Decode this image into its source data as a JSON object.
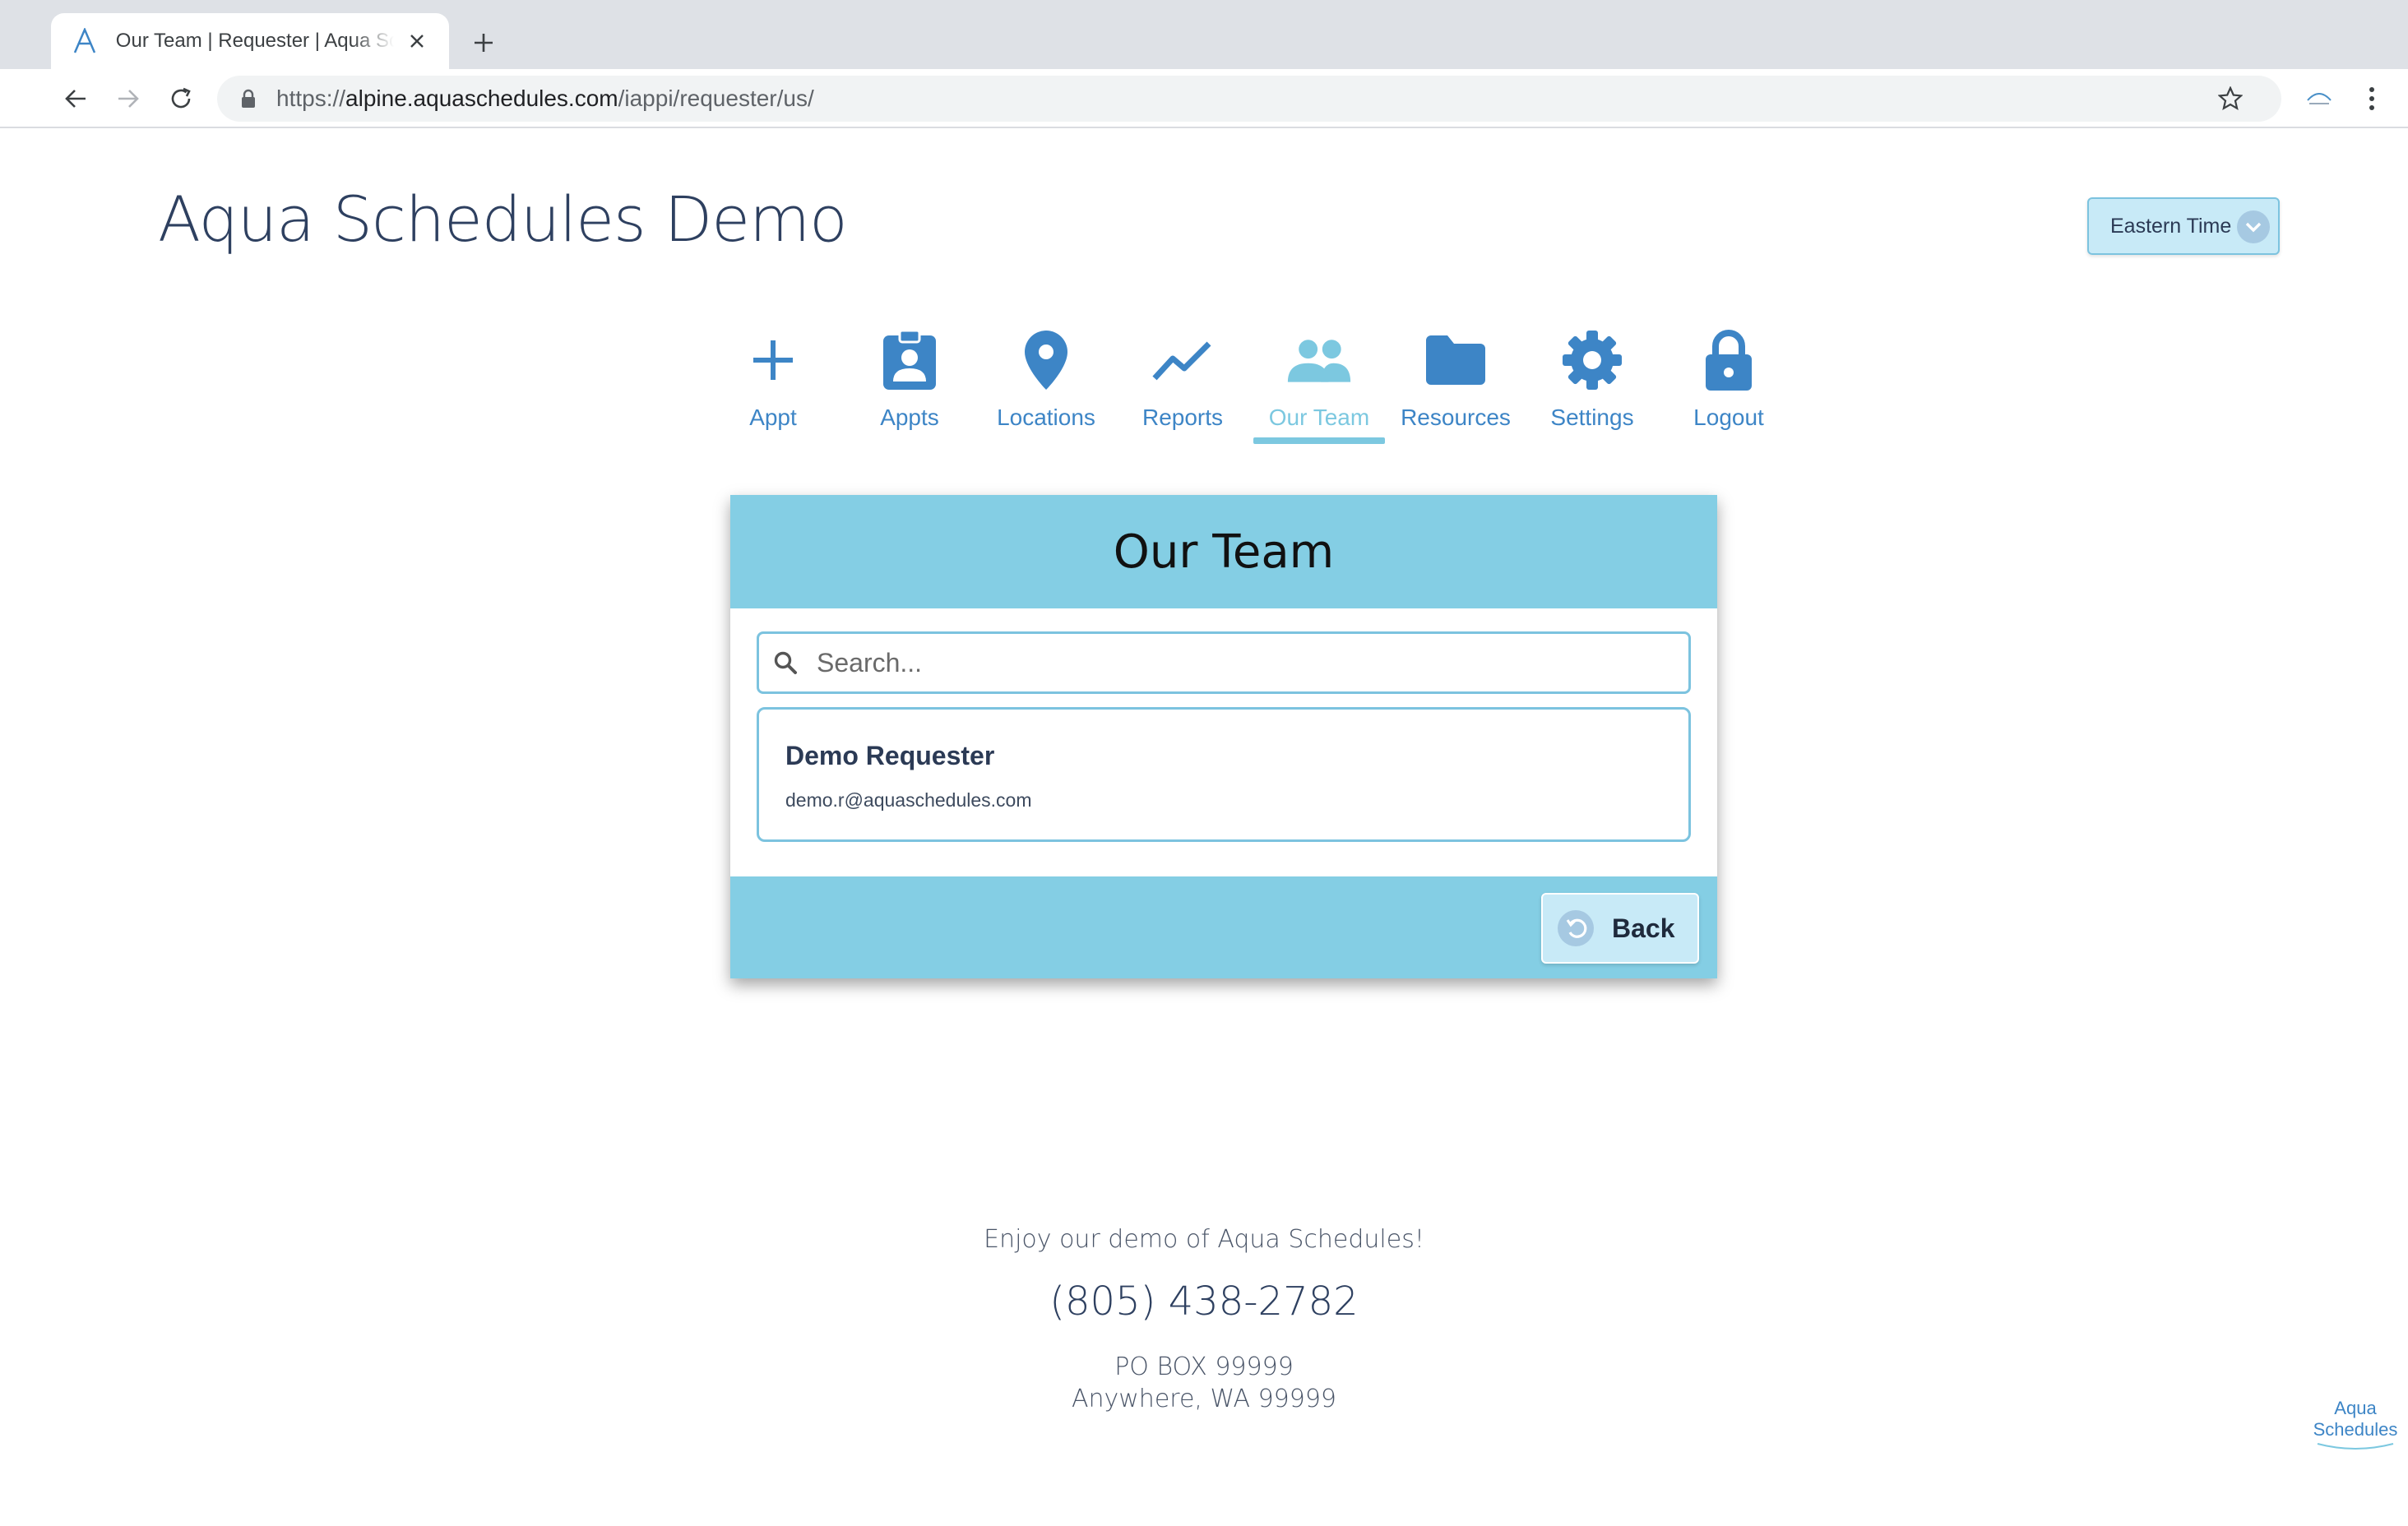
{
  "browser": {
    "tab_title": "Our Team | Requester | Aqua Schedules",
    "url_scheme": "https://",
    "url_host": "alpine.aquaschedules.com",
    "url_path": "/iappi/requester/us/"
  },
  "header": {
    "site_title": "Aqua Schedules Demo",
    "timezone_label": "Eastern Time"
  },
  "nav": {
    "items": [
      {
        "label": "Appt",
        "icon": "plus-icon"
      },
      {
        "label": "Appts",
        "icon": "badge-icon"
      },
      {
        "label": "Locations",
        "icon": "map-pin-icon"
      },
      {
        "label": "Reports",
        "icon": "trend-line-icon"
      },
      {
        "label": "Our Team",
        "icon": "users-icon",
        "active": true
      },
      {
        "label": "Resources",
        "icon": "folder-icon"
      },
      {
        "label": "Settings",
        "icon": "gear-icon"
      },
      {
        "label": "Logout",
        "icon": "lock-icon"
      }
    ]
  },
  "card": {
    "title": "Our Team",
    "search_placeholder": "Search...",
    "members": [
      {
        "name": "Demo Requester",
        "email": "demo.r@aquaschedules.com"
      }
    ],
    "back_label": "Back"
  },
  "footer": {
    "tagline": "Enjoy our demo of Aqua Schedules!",
    "phone": "(805) 438-2782",
    "address_line1": "PO BOX 99999",
    "address_line2": "Anywhere, WA 99999"
  },
  "corner_logo": {
    "line1": "Aqua",
    "line2": "Schedules"
  },
  "colors": {
    "accent": "#3d85c6",
    "active": "#7cc8e0",
    "card_band": "#84cee4",
    "button_bg": "#c8eaf7"
  }
}
